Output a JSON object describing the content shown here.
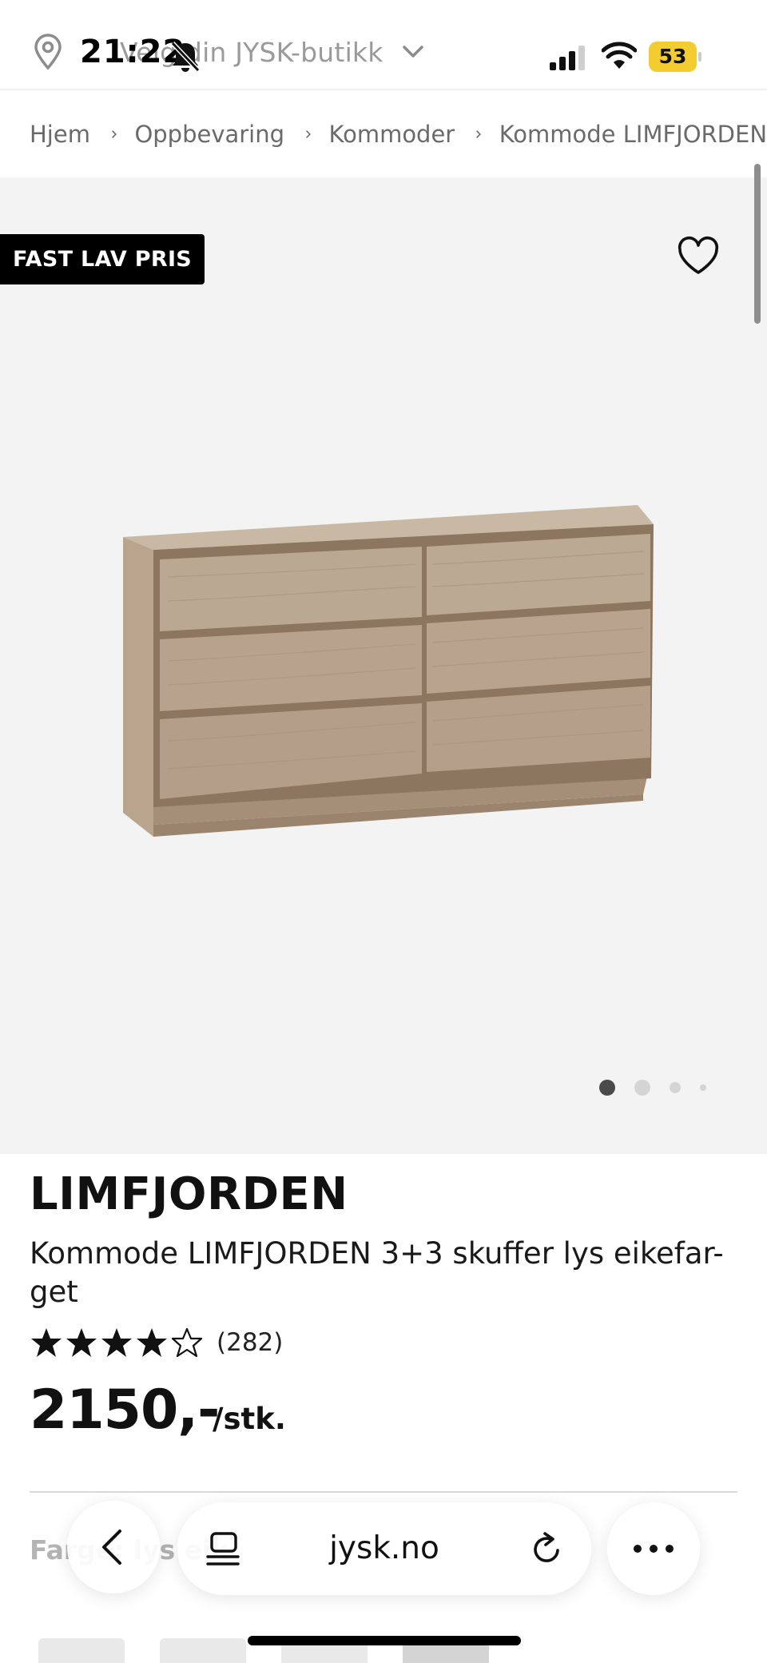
{
  "status_bar": {
    "time": "21:22",
    "battery_percent": "53"
  },
  "store_selector": {
    "label": "Velg din JYSK-butikk"
  },
  "breadcrumb": {
    "items": [
      "Hjem",
      "Oppbevaring",
      "Kommoder",
      "Kommode LIMFJORDEN"
    ]
  },
  "gallery": {
    "badge": "FAST LAV PRIS",
    "image_count": 4,
    "active_index": 0
  },
  "product": {
    "brand": "LIMFJORDEN",
    "title": "Kommode LIMFJORDEN 3+3 skuffer lys eikefar-get",
    "rating": 4,
    "rating_max": 5,
    "review_count": "(282)",
    "price": "2150,-",
    "unit": "/stk.",
    "color_label": "Farge: lys eik"
  },
  "browser": {
    "url": "jysk.no"
  },
  "colors": {
    "badge_bg": "#000000",
    "gallery_bg": "#f3f3f3",
    "battery": "#f3cd2f",
    "muted_text": "#6a6a6a"
  },
  "icons": {
    "location": "map-pin-icon",
    "dropdown": "chevron-down-icon",
    "wishlist": "heart-icon",
    "back": "chevron-left-icon",
    "tabs": "tabs-icon",
    "reload": "reload-icon",
    "more": "more-horizontal-icon"
  }
}
